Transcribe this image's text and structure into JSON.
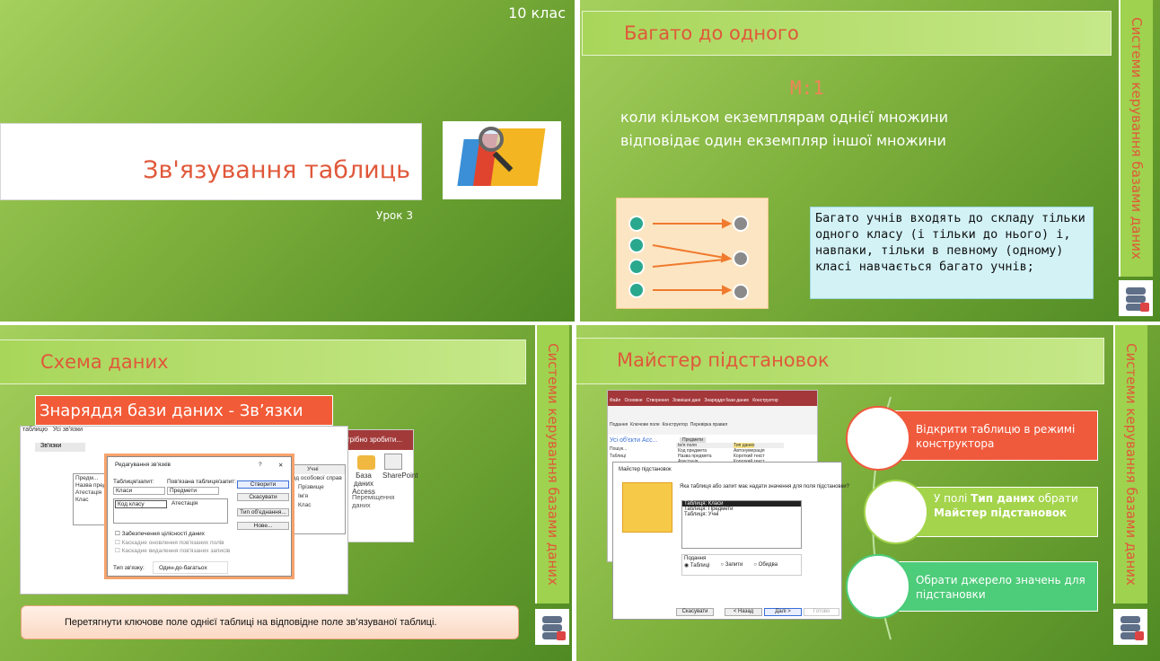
{
  "slide1": {
    "grade": "10 клас",
    "title": "Зв'язування таблиць",
    "subtitle": "Урок 3"
  },
  "sidebar_text": "Системи керування базами даних",
  "slide2": {
    "title": "Багато до одного",
    "ratio": "М:1",
    "definition_line1": "коли кільком екземплярам однієї множини",
    "definition_line2": "відповідає один екземпляр іншої множини",
    "note": "Багато учнів входять до складу тільки одного класу (і тільки до нього) і, навпаки, тільки в певному (одному) класі навчається багато учнів;"
  },
  "slide3": {
    "title": "Схема даних",
    "banner": "Знаряддя бази даних - Зв’язки",
    "caption": "Перетягнути ключове поле однієї таблиці на відповідне поле зв’язуваної таблиці.",
    "dialog": {
      "title": "Редагування зв'язків",
      "help": "?",
      "close": "✕",
      "table_label": "Таблиця/запит:",
      "related_label": "Пов'язана таблиця/запит:",
      "table_value": "Класи",
      "related_value": "Предмети",
      "field_left": "Код класу",
      "field_right": "Атестація",
      "integrity": "Забезпечення цілісності даних",
      "cascade_update": "Каскадне оновлення пов'язаних полів",
      "cascade_delete": "Каскадне видалення пов'язаних записів",
      "type_label": "Тип зв'язку:",
      "type_value": "Один-до-багатьох",
      "btn_create": "Створити",
      "btn_cancel": "Скасувати",
      "btn_join": "Тип об'єднання...",
      "btn_new": "Нове..."
    },
    "bg": {
      "tab_tables": "таблицю",
      "tab_schema": "Зв'язки",
      "tab_all": "Усі зв'язки",
      "ribbon_partial": "трібно зробити...",
      "access_db": "База даних Access",
      "sharepoint": "SharePoint",
      "move_data": "Переміщення даних",
      "left_table": [
        "Предм...",
        "Назва пред",
        "Атестація",
        "Клас"
      ],
      "right_table_title": "Учні",
      "right_table": [
        "Код особової справ",
        "Прізвище",
        "Ім'я",
        "Клас"
      ]
    }
  },
  "slide4": {
    "title": "Майстер підстановок",
    "steps": [
      "Відкрити таблицю в режимі конструктора",
      {
        "pre": "У полі ",
        "b1": "Тип даних",
        "mid": " обрати ",
        "b2": "Майстер підстановок"
      },
      "Обрати джерело значень для підстановки"
    ],
    "wizard": {
      "title": "Майстер підстановок",
      "question": "Яка таблиця або запит має надати значення для поля підстановки?",
      "list": [
        "Таблиця: Класи",
        "Таблиця: Предмети",
        "Таблиця: Учні"
      ],
      "view_label": "Подання",
      "radio_tables": "Таблиці",
      "radio_queries": "Запити",
      "radio_both": "Обидва",
      "btn_cancel": "Скасувати",
      "btn_back": "< Назад",
      "btn_next": "Далі >",
      "btn_finish": "Готово"
    },
    "access": {
      "nav_header": "Усі об'єкти Acc...",
      "search": "Пошук...",
      "tables": "Таблиці",
      "col_field": "Ім'я поля",
      "col_type": "Тип даних",
      "rows": [
        [
          "Код предмета",
          "Автонумерація"
        ],
        [
          "Назва предмета",
          "Короткий текст"
        ],
        [
          "Атестація",
          "Короткий текст"
        ]
      ],
      "tab": "Предмети",
      "menu": [
        "Файл",
        "Основне",
        "Створення",
        "Зовнішні дані",
        "Знаряддя бази даних",
        "Конструктор"
      ],
      "ribbon": [
        "Подання",
        "Ключове поле",
        "Конструктор",
        "Перевірка правил"
      ]
    }
  }
}
